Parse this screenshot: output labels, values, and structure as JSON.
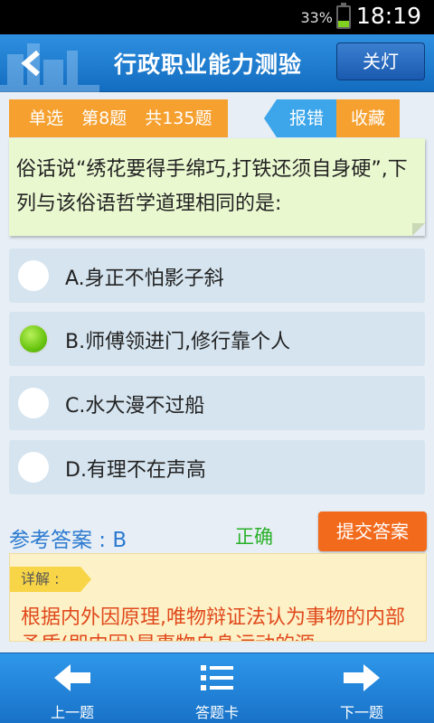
{
  "status_bar": {
    "battery_percent": "33%",
    "battery_level": 0.33,
    "time": "18:19"
  },
  "header": {
    "back_icon": "back-arrow-icon",
    "title": "行政职业能力测验",
    "lights_button": "关灯"
  },
  "question_info": {
    "type": "单选",
    "number": "第8题",
    "total": "共135题"
  },
  "actions": {
    "report": "报错",
    "favorite": "收藏"
  },
  "question": {
    "text": "俗话说“绣花要得手绵巧,打铁还须自身硬”,下列与该俗语哲学道理相同的是:"
  },
  "options": [
    {
      "label": "A.身正不怕影子斜",
      "selected": false
    },
    {
      "label": "B.师傅领进门,修行靠个人",
      "selected": true
    },
    {
      "label": "C.水大漫不过船",
      "selected": false
    },
    {
      "label": "D.有理不在声高",
      "selected": false
    }
  ],
  "answer": {
    "label": "参考答案 : B",
    "result": "正确",
    "submit_button": "提交答案"
  },
  "explanation": {
    "tag": "详解 :",
    "text": "根据内外因原理,唯物辩证法认为事物的内部矛盾(即内因)是事物自身运动的源"
  },
  "bottom_nav": {
    "prev": "上一题",
    "card": "答题卡",
    "next": "下一题"
  },
  "colors": {
    "header": "#1f7fd4",
    "orange": "#f5a02f",
    "selected": "#69c510",
    "explain_text": "#e0491c"
  }
}
